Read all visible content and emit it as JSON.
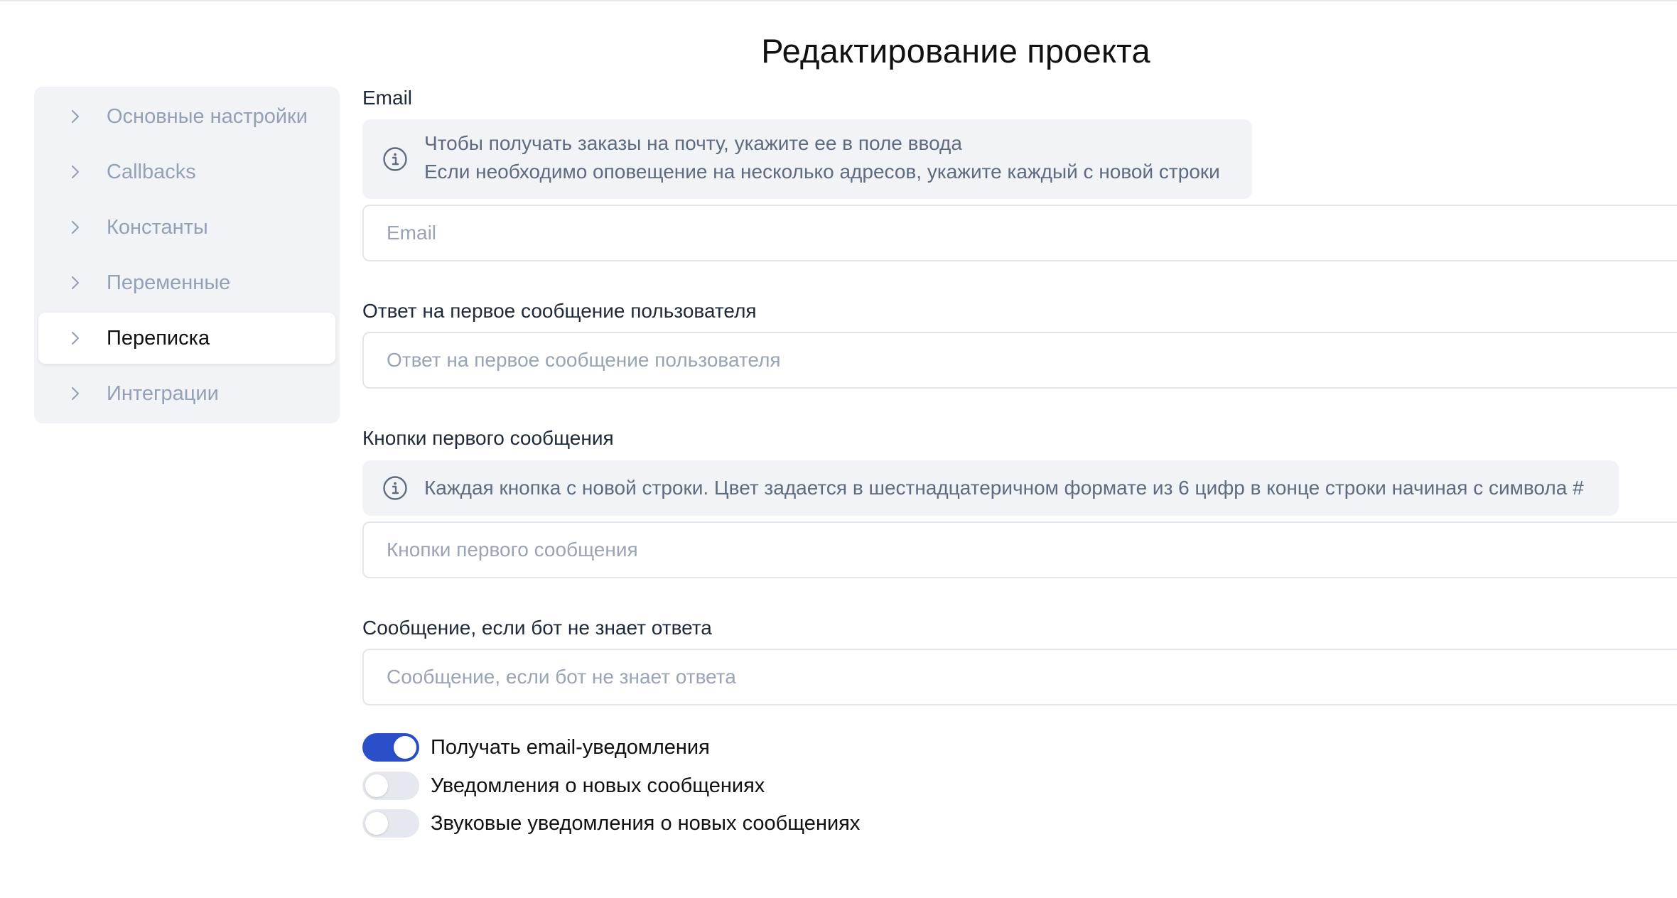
{
  "page_title": "Редактирование проекта",
  "sidebar": {
    "items": [
      {
        "label": "Основные настройки",
        "active": false
      },
      {
        "label": "Callbacks",
        "active": false
      },
      {
        "label": "Константы",
        "active": false
      },
      {
        "label": "Переменные",
        "active": false
      },
      {
        "label": "Переписка",
        "active": true
      },
      {
        "label": "Интеграции",
        "active": false
      }
    ]
  },
  "form": {
    "email": {
      "label": "Email",
      "info_line1": "Чтобы получать заказы на почту, укажите ее в поле ввода",
      "info_line2": "Если необходимо оповещение на несколько адресов, укажите каждый с новой строки",
      "placeholder": "Email",
      "value": ""
    },
    "first_reply": {
      "label": "Ответ на первое сообщение пользователя",
      "placeholder": "Ответ на первое сообщение пользователя",
      "value": ""
    },
    "first_buttons": {
      "label": "Кнопки первого сообщения",
      "info": "Каждая кнопка с новой строки. Цвет задается в шестнадцатеричном формате из 6 цифр в конце строки начиная с символа #",
      "placeholder": "Кнопки первого сообщения",
      "value": ""
    },
    "unknown_reply": {
      "label": "Сообщение, если бот не знает ответа",
      "placeholder": "Сообщение, если бот не знает ответа",
      "value": ""
    }
  },
  "toggles": [
    {
      "label": "Получать email-уведомления",
      "on": true
    },
    {
      "label": "Уведомления о новых сообщениях",
      "on": false
    },
    {
      "label": "Звуковые уведомления о новых сообщениях",
      "on": false
    }
  ],
  "colors": {
    "accent": "#2a4fc8",
    "sidebar_bg": "#f1f3f6",
    "muted_text": "#94a0b4",
    "info_text": "#5f6b7e",
    "input_border": "#e2e5ea"
  },
  "icons": {
    "sidebar_item": "chevron-right-icon",
    "info_box": "info-circle-icon"
  }
}
